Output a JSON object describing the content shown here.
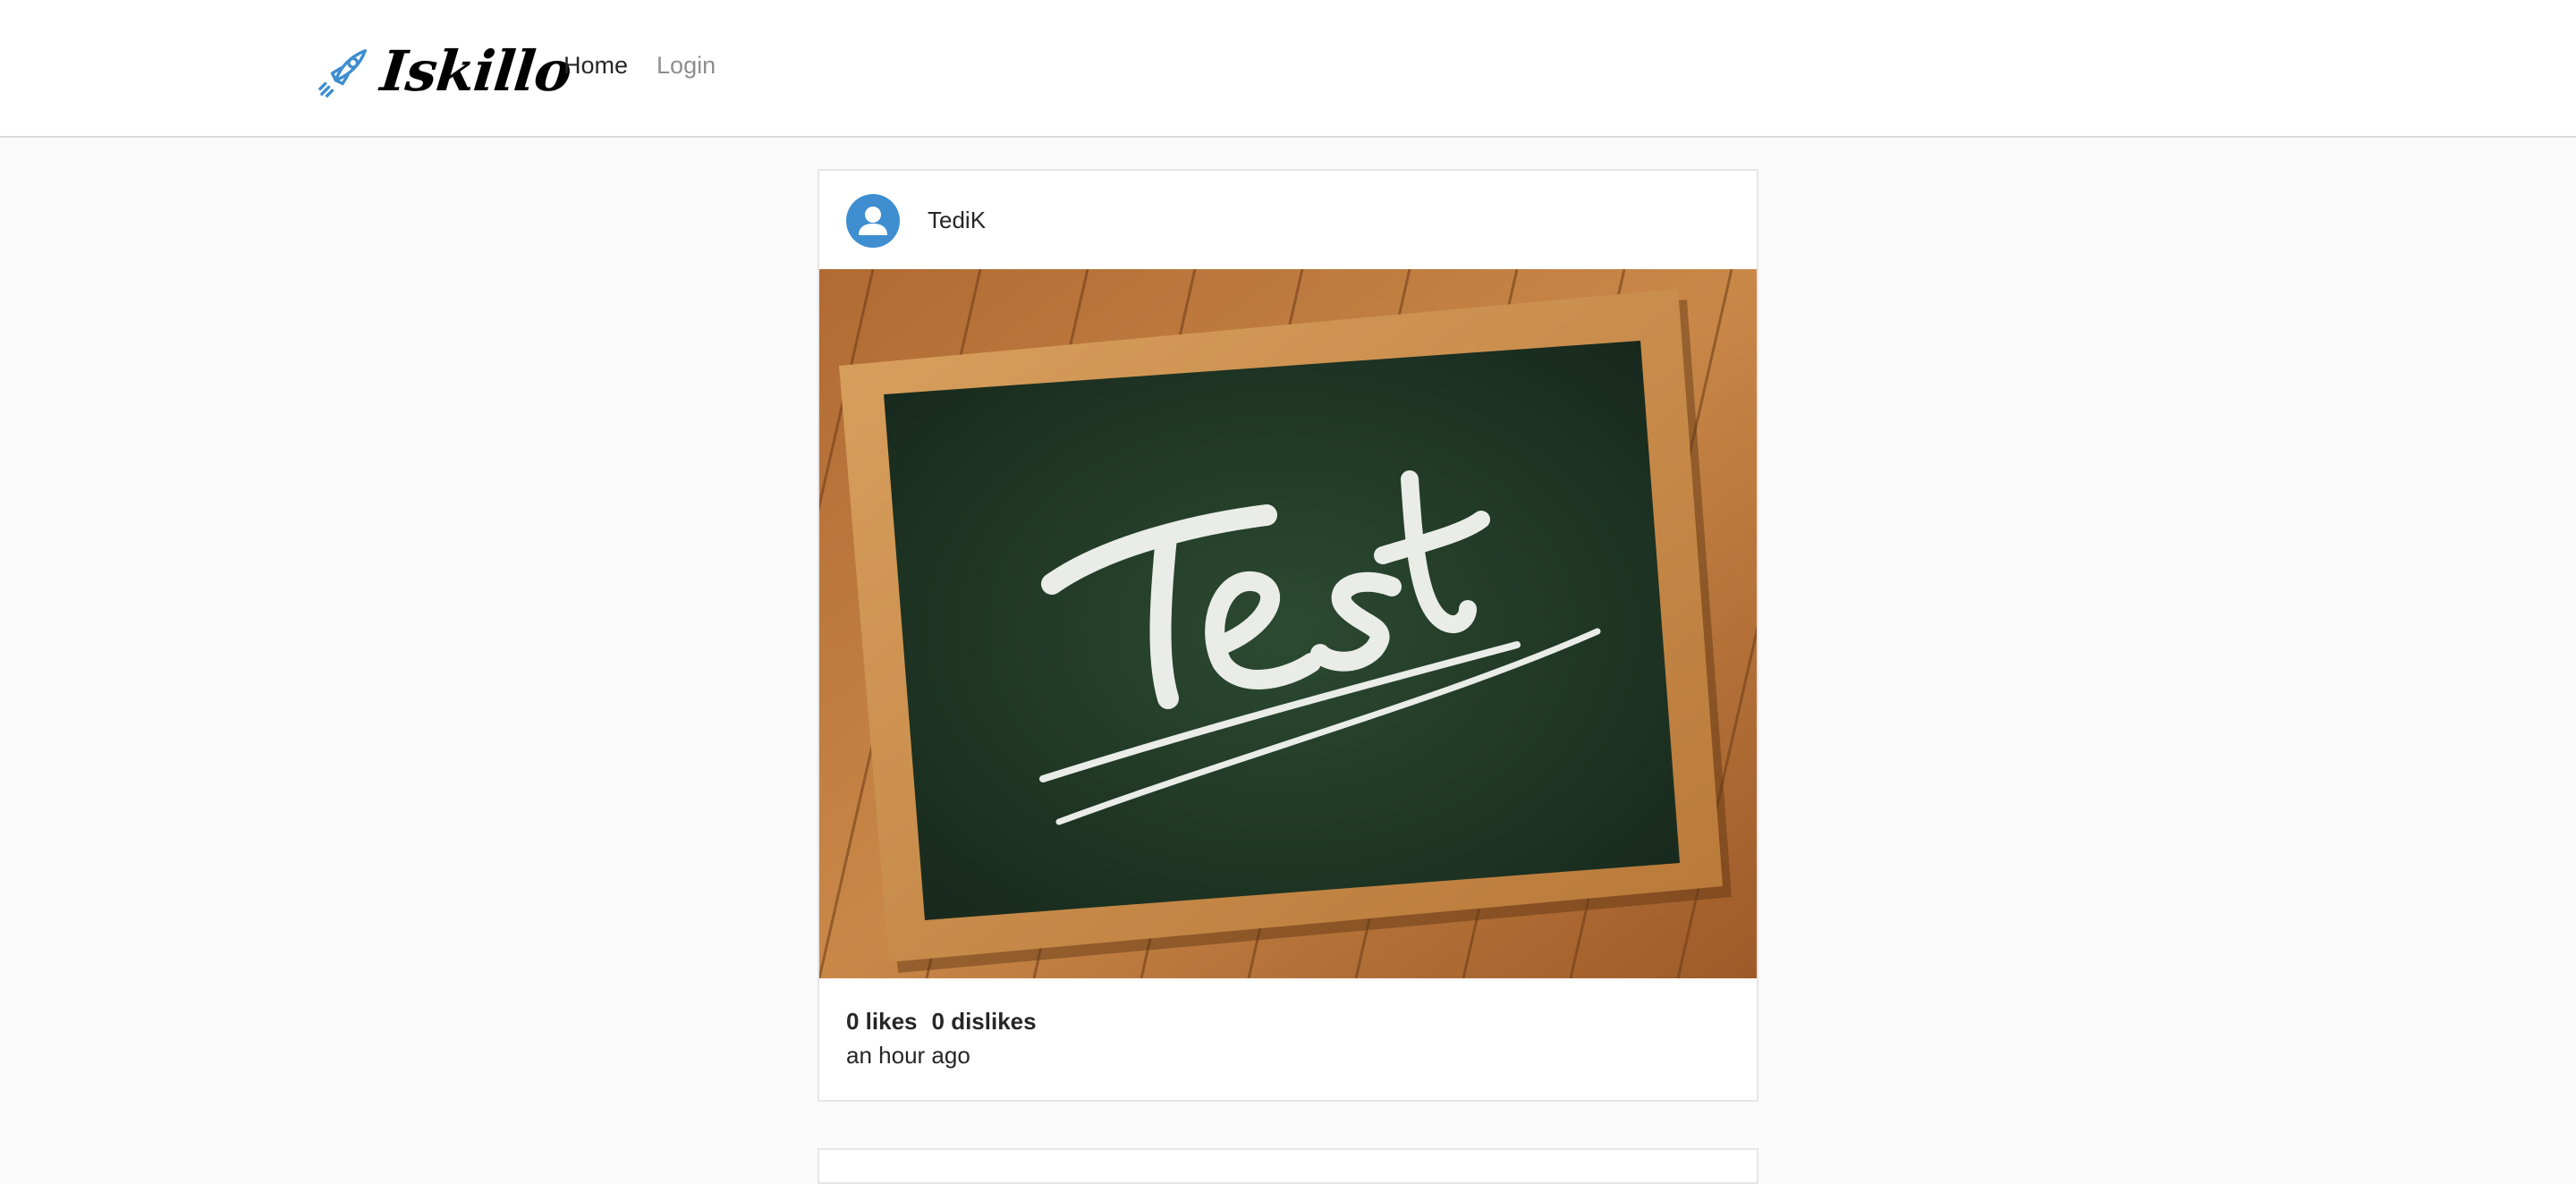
{
  "header": {
    "brand_name": "Iskillo",
    "brand_icon": "rocket-icon",
    "nav": [
      {
        "label": "Home",
        "active": true
      },
      {
        "label": "Login",
        "active": false
      }
    ]
  },
  "posts": [
    {
      "author": "TediK",
      "avatar_icon": "user-avatar-icon",
      "image_caption_text": "Test",
      "likes": "0 likes",
      "dislikes": "0 dislikes",
      "time_ago": "an hour ago"
    }
  ],
  "colors": {
    "accent": "#3e8ed0",
    "border": "#dbdbdb",
    "background": "#fafafa"
  }
}
